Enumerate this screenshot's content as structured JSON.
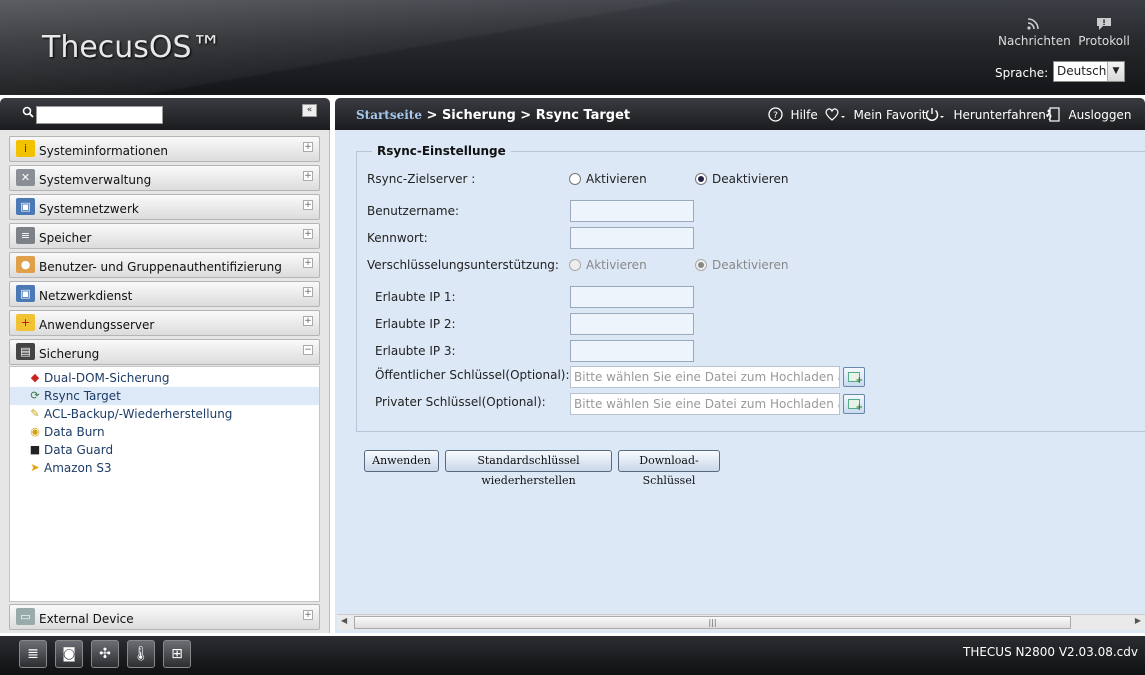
{
  "app": {
    "logo": "ThecusOS™"
  },
  "header": {
    "news_label": "Nachrichten",
    "log_label": "Protokoll",
    "language_label": "Sprache:",
    "language_value": "Deutsch"
  },
  "sidebar": {
    "search_placeholder": "",
    "items": [
      {
        "label": "Systeminformationen",
        "icon": "info-icon",
        "expanded": false
      },
      {
        "label": "Systemverwaltung",
        "icon": "tools-icon",
        "expanded": false
      },
      {
        "label": "Systemnetzwerk",
        "icon": "network-icon",
        "expanded": false
      },
      {
        "label": "Speicher",
        "icon": "storage-icon",
        "expanded": false
      },
      {
        "label": "Benutzer- und Gruppenauthentifizierung",
        "icon": "users-icon",
        "expanded": false
      },
      {
        "label": "Netzwerkdienst",
        "icon": "network-service-icon",
        "expanded": false
      },
      {
        "label": "Anwendungsserver",
        "icon": "app-server-icon",
        "expanded": false
      },
      {
        "label": "Sicherung",
        "icon": "backup-icon",
        "expanded": true
      },
      {
        "label": "External Device",
        "icon": "external-device-icon",
        "expanded": false
      }
    ],
    "sub_items": [
      {
        "label": "Dual-DOM-Sicherung",
        "icon": "dual-dom-icon",
        "active": false
      },
      {
        "label": "Rsync Target",
        "icon": "rsync-icon",
        "active": true
      },
      {
        "label": "ACL-Backup/-Wiederherstellung",
        "icon": "acl-icon",
        "active": false
      },
      {
        "label": "Data Burn",
        "icon": "data-burn-icon",
        "active": false
      },
      {
        "label": "Data Guard",
        "icon": "data-guard-icon",
        "active": false
      },
      {
        "label": "Amazon S3",
        "icon": "amazon-s3-icon",
        "active": false
      }
    ]
  },
  "breadcrumb": {
    "home": "Startseite",
    "separator": " > ",
    "section": "Sicherung",
    "page": "Rsync Target"
  },
  "toolbar": {
    "help": "Hilfe",
    "favorite": "Mein Favorit",
    "shutdown": "Herunterfahren",
    "logout": "Ausloggen"
  },
  "form": {
    "legend": "Rsync-Einstellunge",
    "target_server_label": "Rsync-Zielserver :",
    "enable": "Aktivieren",
    "disable": "Deaktivieren",
    "target_server_selected": "Deaktivieren",
    "username_label": "Benutzername:",
    "username_value": "",
    "password_label": "Kennwort:",
    "password_value": "",
    "encryption_label": "Verschlüsselungsunterstützung:",
    "encryption_selected": "Deaktivieren",
    "allowed_ip1_label": "Erlaubte IP 1:",
    "allowed_ip2_label": "Erlaubte IP 2:",
    "allowed_ip3_label": "Erlaubte IP 3:",
    "public_key_label": "Öffentlicher Schlüssel(Optional):",
    "private_key_label": "Privater Schlüssel(Optional):",
    "file_placeholder": "Bitte wählen Sie eine Datei zum Hochladen aus."
  },
  "buttons": {
    "apply": "Anwenden",
    "restore_default_keys": "Standardschlüssel wiederherstellen",
    "download_key": "Download-Schlüssel"
  },
  "footer": {
    "version": "THECUS N2800 V2.03.08.cdv",
    "icons": [
      "server-status-icon",
      "disk-icon",
      "fan-icon",
      "temperature-icon",
      "network-status-icon"
    ]
  }
}
